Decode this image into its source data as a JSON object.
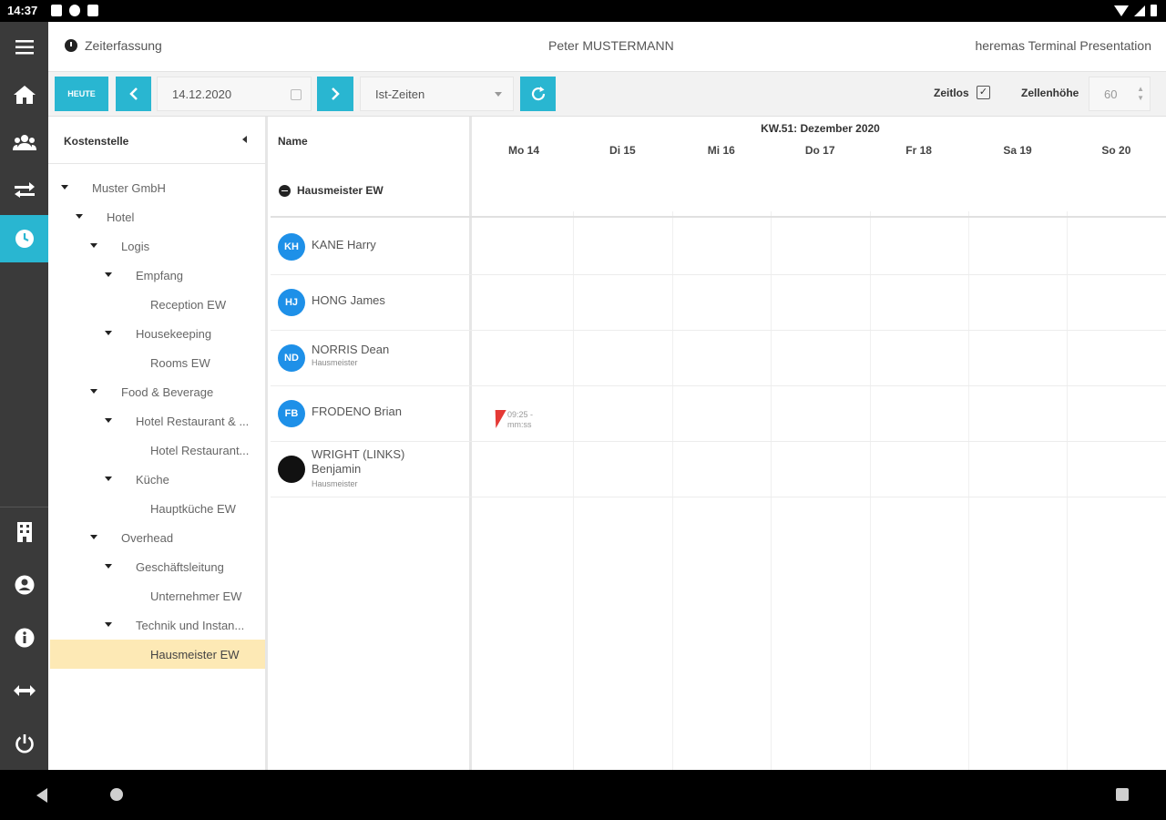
{
  "status_bar": {
    "time": "14:37"
  },
  "header": {
    "module": "Zeiterfassung",
    "user": "Peter MUSTERMANN",
    "terminal": "heremas Terminal Presentation"
  },
  "toolbar": {
    "today_label": "HEUTE",
    "date_value": "14.12.2020",
    "mode_value": "Ist-Zeiten",
    "timeless_label": "Zeitlos",
    "row_height_label": "Zellenhöhe",
    "row_height_value": "60"
  },
  "sidebar_icons": [
    "menu-icon",
    "home-icon",
    "users-icon",
    "swap-icon",
    "clock-icon",
    "building-icon",
    "account-icon",
    "info-icon",
    "resize-icon",
    "power-icon"
  ],
  "tree": {
    "header": "Kostenstelle",
    "nodes": [
      {
        "label": "Muster GmbH",
        "level": 0,
        "expandable": true
      },
      {
        "label": "Hotel",
        "level": 1,
        "expandable": true
      },
      {
        "label": "Logis",
        "level": 2,
        "expandable": true
      },
      {
        "label": "Empfang",
        "level": 3,
        "expandable": true
      },
      {
        "label": "Reception EW",
        "level": 4,
        "expandable": false
      },
      {
        "label": "Housekeeping",
        "level": 3,
        "expandable": true
      },
      {
        "label": "Rooms EW",
        "level": 4,
        "expandable": false
      },
      {
        "label": "Food & Beverage",
        "level": 2,
        "expandable": true
      },
      {
        "label": "Hotel Restaurant & ...",
        "level": 3,
        "expandable": true
      },
      {
        "label": "Hotel Restaurant...",
        "level": 4,
        "expandable": false
      },
      {
        "label": "Küche",
        "level": 3,
        "expandable": true
      },
      {
        "label": "Hauptküche EW",
        "level": 4,
        "expandable": false
      },
      {
        "label": "Overhead",
        "level": 2,
        "expandable": true
      },
      {
        "label": "Geschäftsleitung",
        "level": 3,
        "expandable": true
      },
      {
        "label": "Unternehmer EW",
        "level": 4,
        "expandable": false
      },
      {
        "label": "Technik und Instan...",
        "level": 3,
        "expandable": true
      },
      {
        "label": "Hausmeister EW",
        "level": 4,
        "expandable": false,
        "selected": true
      }
    ]
  },
  "grid": {
    "name_header": "Name",
    "week_title": "KW.51: Dezember 2020",
    "days": [
      "Mo 14",
      "Di 15",
      "Mi 16",
      "Do 17",
      "Fr 18",
      "Sa 19",
      "So 20"
    ],
    "group": "Hausmeister EW",
    "employees": [
      {
        "initials": "KH",
        "name": "KANE Harry",
        "role": ""
      },
      {
        "initials": "HJ",
        "name": "HONG James",
        "role": ""
      },
      {
        "initials": "ND",
        "name": "NORRIS Dean",
        "role": "Hausmeister"
      },
      {
        "initials": "FB",
        "name": "FRODENO Brian",
        "role": ""
      },
      {
        "initials": "",
        "name": "WRIGHT (LINKS) Benjamin",
        "role": "Hausmeister"
      }
    ],
    "entry": {
      "time_from": "09:25 -",
      "time_sub": "mm:ss"
    }
  },
  "colors": {
    "accent": "#29b6d1",
    "avatar": "#1e90e8",
    "selected": "#fde9b5",
    "sidebar": "#3a3a3a",
    "alert": "#e53935"
  }
}
